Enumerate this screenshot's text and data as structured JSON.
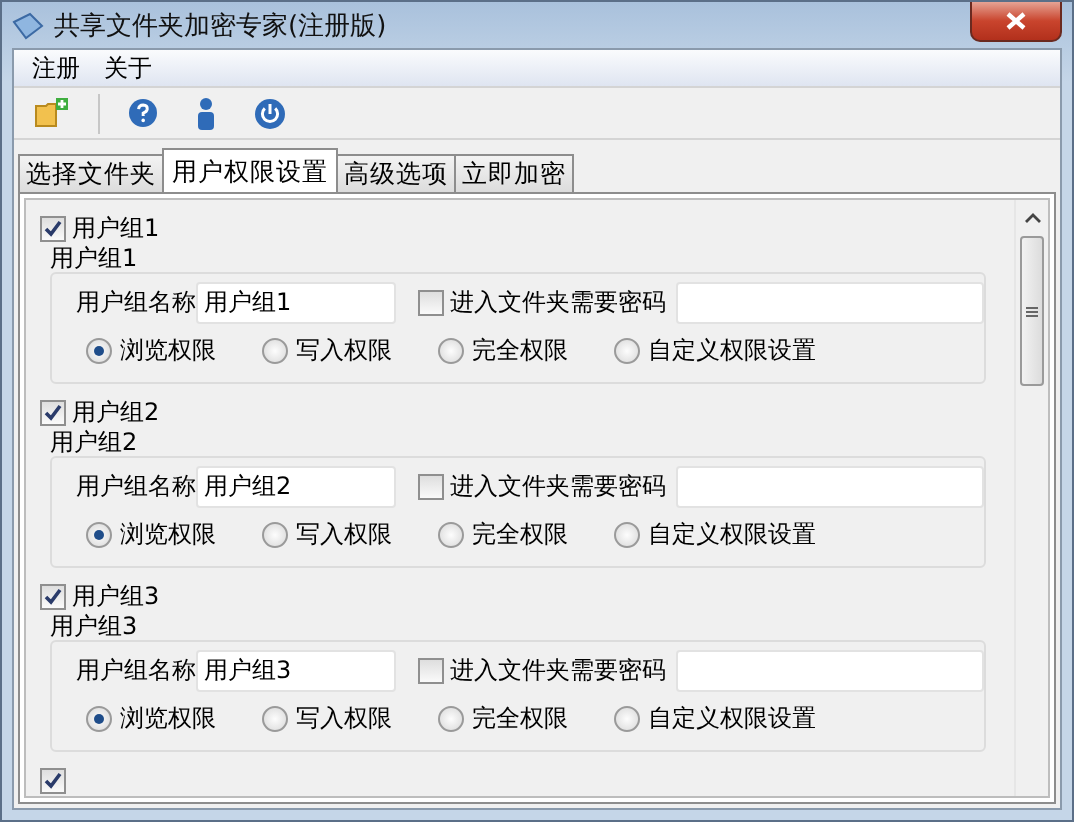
{
  "window": {
    "title": "共享文件夹加密专家(注册版)"
  },
  "menu": [
    "注册",
    "关于"
  ],
  "tabs": [
    {
      "label": "选择文件夹",
      "selected": false
    },
    {
      "label": "用户权限设置",
      "selected": true
    },
    {
      "label": "高级选项",
      "selected": false
    },
    {
      "label": "立即加密",
      "selected": false
    }
  ],
  "groups": [
    {
      "enabled": true,
      "label": "用户组1",
      "frame_title": "用户组1",
      "name_label": "用户组名称",
      "name_value": "用户组1",
      "password_label": "进入文件夹需要密码",
      "password_required": false,
      "permissions": [
        {
          "label": "浏览权限",
          "selected": true
        },
        {
          "label": "写入权限",
          "selected": false
        },
        {
          "label": "完全权限",
          "selected": false
        },
        {
          "label": "自定义权限设置",
          "selected": false
        }
      ]
    },
    {
      "enabled": true,
      "label": "用户组2",
      "frame_title": "用户组2",
      "name_label": "用户组名称",
      "name_value": "用户组2",
      "password_label": "进入文件夹需要密码",
      "password_required": false,
      "permissions": [
        {
          "label": "浏览权限",
          "selected": true
        },
        {
          "label": "写入权限",
          "selected": false
        },
        {
          "label": "完全权限",
          "selected": false
        },
        {
          "label": "自定义权限设置",
          "selected": false
        }
      ]
    },
    {
      "enabled": true,
      "label": "用户组3",
      "frame_title": "用户组3",
      "name_label": "用户组名称",
      "name_value": "用户组3",
      "password_label": "进入文件夹需要密码",
      "password_required": false,
      "permissions": [
        {
          "label": "浏览权限",
          "selected": true
        },
        {
          "label": "写入权限",
          "selected": false
        },
        {
          "label": "完全权限",
          "selected": false
        },
        {
          "label": "自定义权限设置",
          "selected": false
        }
      ]
    },
    {
      "enabled": true
    }
  ]
}
